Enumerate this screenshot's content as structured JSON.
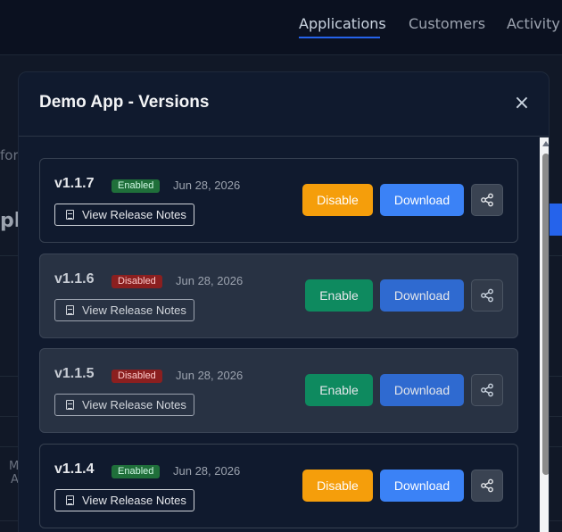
{
  "nav": {
    "items": [
      {
        "label": "Applications",
        "active": true
      },
      {
        "label": "Customers",
        "active": false
      },
      {
        "label": "Activity",
        "active": false
      }
    ]
  },
  "background": {
    "fragment_for": "for",
    "fragment_pl": "pl",
    "fragment_m": "M",
    "fragment_a": "A"
  },
  "modal": {
    "title": "Demo App - Versions",
    "close_label": "×",
    "versions": [
      {
        "version": "v1.1.7",
        "status": "Enabled",
        "date": "Jun 28, 2026",
        "notes_label": "View Release Notes",
        "toggle_label": "Disable",
        "download_label": "Download"
      },
      {
        "version": "v1.1.6",
        "status": "Disabled",
        "date": "Jun 28, 2026",
        "notes_label": "View Release Notes",
        "toggle_label": "Enable",
        "download_label": "Download"
      },
      {
        "version": "v1.1.5",
        "status": "Disabled",
        "date": "Jun 28, 2026",
        "notes_label": "View Release Notes",
        "toggle_label": "Enable",
        "download_label": "Download"
      },
      {
        "version": "v1.1.4",
        "status": "Enabled",
        "date": "Jun 28, 2026",
        "notes_label": "View Release Notes",
        "toggle_label": "Disable",
        "download_label": "Download"
      }
    ]
  },
  "colors": {
    "enabled_badge": "#1f6f3a",
    "disabled_badge": "#8b1f1f",
    "disable_button": "#f59e0b",
    "enable_button": "#10996a",
    "download_button": "#3b82f6"
  },
  "icons": {
    "close": "close-icon",
    "notes": "document-icon",
    "share": "share-icon"
  }
}
